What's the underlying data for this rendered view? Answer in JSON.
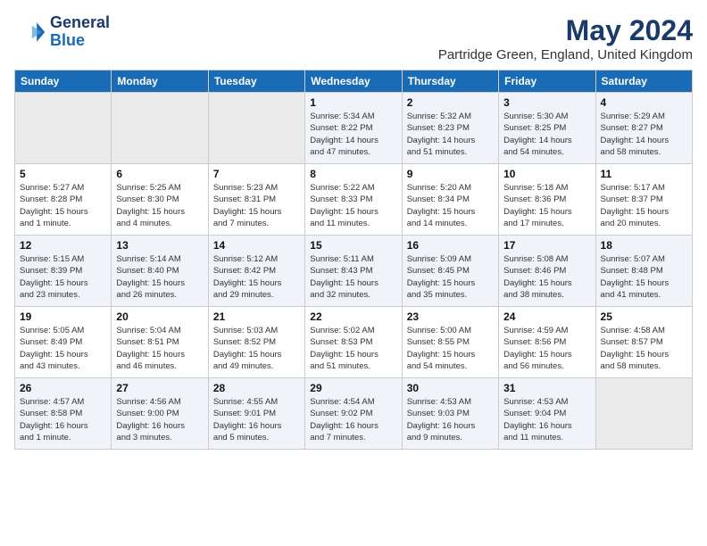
{
  "logo": {
    "line1": "General",
    "line2": "Blue"
  },
  "title": "May 2024",
  "subtitle": "Partridge Green, England, United Kingdom",
  "weekdays": [
    "Sunday",
    "Monday",
    "Tuesday",
    "Wednesday",
    "Thursday",
    "Friday",
    "Saturday"
  ],
  "weeks": [
    [
      {
        "day": "",
        "info": ""
      },
      {
        "day": "",
        "info": ""
      },
      {
        "day": "",
        "info": ""
      },
      {
        "day": "1",
        "info": "Sunrise: 5:34 AM\nSunset: 8:22 PM\nDaylight: 14 hours\nand 47 minutes."
      },
      {
        "day": "2",
        "info": "Sunrise: 5:32 AM\nSunset: 8:23 PM\nDaylight: 14 hours\nand 51 minutes."
      },
      {
        "day": "3",
        "info": "Sunrise: 5:30 AM\nSunset: 8:25 PM\nDaylight: 14 hours\nand 54 minutes."
      },
      {
        "day": "4",
        "info": "Sunrise: 5:29 AM\nSunset: 8:27 PM\nDaylight: 14 hours\nand 58 minutes."
      }
    ],
    [
      {
        "day": "5",
        "info": "Sunrise: 5:27 AM\nSunset: 8:28 PM\nDaylight: 15 hours\nand 1 minute."
      },
      {
        "day": "6",
        "info": "Sunrise: 5:25 AM\nSunset: 8:30 PM\nDaylight: 15 hours\nand 4 minutes."
      },
      {
        "day": "7",
        "info": "Sunrise: 5:23 AM\nSunset: 8:31 PM\nDaylight: 15 hours\nand 7 minutes."
      },
      {
        "day": "8",
        "info": "Sunrise: 5:22 AM\nSunset: 8:33 PM\nDaylight: 15 hours\nand 11 minutes."
      },
      {
        "day": "9",
        "info": "Sunrise: 5:20 AM\nSunset: 8:34 PM\nDaylight: 15 hours\nand 14 minutes."
      },
      {
        "day": "10",
        "info": "Sunrise: 5:18 AM\nSunset: 8:36 PM\nDaylight: 15 hours\nand 17 minutes."
      },
      {
        "day": "11",
        "info": "Sunrise: 5:17 AM\nSunset: 8:37 PM\nDaylight: 15 hours\nand 20 minutes."
      }
    ],
    [
      {
        "day": "12",
        "info": "Sunrise: 5:15 AM\nSunset: 8:39 PM\nDaylight: 15 hours\nand 23 minutes."
      },
      {
        "day": "13",
        "info": "Sunrise: 5:14 AM\nSunset: 8:40 PM\nDaylight: 15 hours\nand 26 minutes."
      },
      {
        "day": "14",
        "info": "Sunrise: 5:12 AM\nSunset: 8:42 PM\nDaylight: 15 hours\nand 29 minutes."
      },
      {
        "day": "15",
        "info": "Sunrise: 5:11 AM\nSunset: 8:43 PM\nDaylight: 15 hours\nand 32 minutes."
      },
      {
        "day": "16",
        "info": "Sunrise: 5:09 AM\nSunset: 8:45 PM\nDaylight: 15 hours\nand 35 minutes."
      },
      {
        "day": "17",
        "info": "Sunrise: 5:08 AM\nSunset: 8:46 PM\nDaylight: 15 hours\nand 38 minutes."
      },
      {
        "day": "18",
        "info": "Sunrise: 5:07 AM\nSunset: 8:48 PM\nDaylight: 15 hours\nand 41 minutes."
      }
    ],
    [
      {
        "day": "19",
        "info": "Sunrise: 5:05 AM\nSunset: 8:49 PM\nDaylight: 15 hours\nand 43 minutes."
      },
      {
        "day": "20",
        "info": "Sunrise: 5:04 AM\nSunset: 8:51 PM\nDaylight: 15 hours\nand 46 minutes."
      },
      {
        "day": "21",
        "info": "Sunrise: 5:03 AM\nSunset: 8:52 PM\nDaylight: 15 hours\nand 49 minutes."
      },
      {
        "day": "22",
        "info": "Sunrise: 5:02 AM\nSunset: 8:53 PM\nDaylight: 15 hours\nand 51 minutes."
      },
      {
        "day": "23",
        "info": "Sunrise: 5:00 AM\nSunset: 8:55 PM\nDaylight: 15 hours\nand 54 minutes."
      },
      {
        "day": "24",
        "info": "Sunrise: 4:59 AM\nSunset: 8:56 PM\nDaylight: 15 hours\nand 56 minutes."
      },
      {
        "day": "25",
        "info": "Sunrise: 4:58 AM\nSunset: 8:57 PM\nDaylight: 15 hours\nand 58 minutes."
      }
    ],
    [
      {
        "day": "26",
        "info": "Sunrise: 4:57 AM\nSunset: 8:58 PM\nDaylight: 16 hours\nand 1 minute."
      },
      {
        "day": "27",
        "info": "Sunrise: 4:56 AM\nSunset: 9:00 PM\nDaylight: 16 hours\nand 3 minutes."
      },
      {
        "day": "28",
        "info": "Sunrise: 4:55 AM\nSunset: 9:01 PM\nDaylight: 16 hours\nand 5 minutes."
      },
      {
        "day": "29",
        "info": "Sunrise: 4:54 AM\nSunset: 9:02 PM\nDaylight: 16 hours\nand 7 minutes."
      },
      {
        "day": "30",
        "info": "Sunrise: 4:53 AM\nSunset: 9:03 PM\nDaylight: 16 hours\nand 9 minutes."
      },
      {
        "day": "31",
        "info": "Sunrise: 4:53 AM\nSunset: 9:04 PM\nDaylight: 16 hours\nand 11 minutes."
      },
      {
        "day": "",
        "info": ""
      }
    ]
  ]
}
